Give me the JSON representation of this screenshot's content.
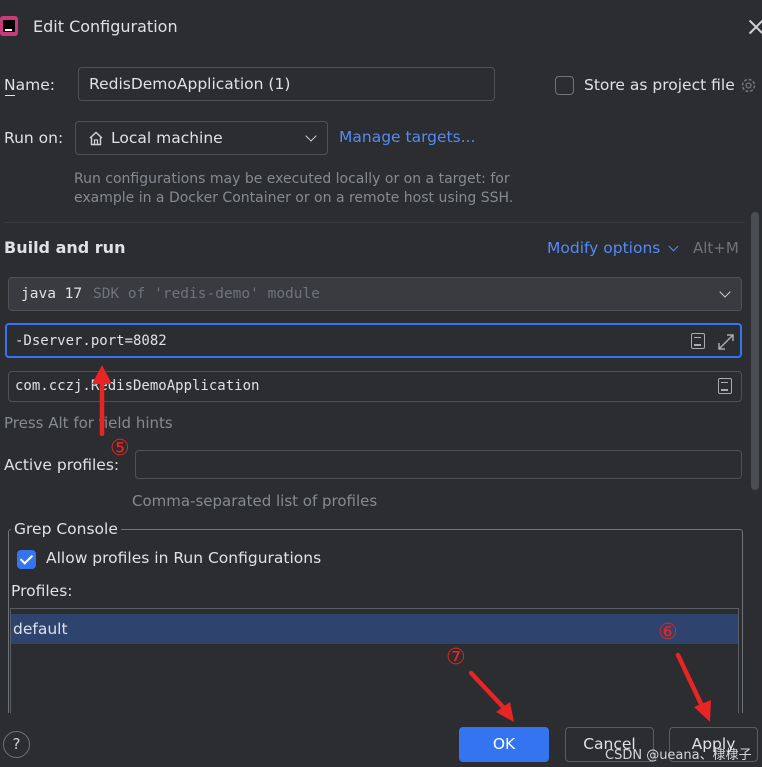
{
  "dialog": {
    "title": "Edit Configuration"
  },
  "name_field": {
    "label": "Name:",
    "value": "RedisDemoApplication (1)"
  },
  "store_as_project": {
    "label": "Store as project file",
    "checked": false
  },
  "run_on": {
    "label": "Run on:",
    "target": "Local machine",
    "manage_link": "Manage targets...",
    "hint": "Run configurations may be executed locally or on a target: for example in a Docker Container or on a remote host using SSH."
  },
  "build_run": {
    "heading": "Build and run",
    "modify_options": "Modify options",
    "shortcut": "Alt+M",
    "jdk": {
      "version": "java 17",
      "description": "SDK of 'redis-demo' module"
    },
    "vm_options": "-Dserver.port=8082",
    "main_class": "com.cczj.RedisDemoApplication",
    "field_hints": "Press Alt for field hints"
  },
  "active_profiles": {
    "label": "Active profiles:",
    "value": "",
    "hint": "Comma-separated list of profiles"
  },
  "grep_console": {
    "legend": "Grep Console",
    "allow_label": "Allow profiles in Run Configurations",
    "allow_checked": true,
    "profiles_label": "Profiles:",
    "profiles": [
      "default"
    ],
    "selected_profile": "default"
  },
  "annotations": {
    "five": "⑤",
    "six": "⑥",
    "seven": "⑦"
  },
  "buttons": {
    "help": "?",
    "ok": "OK",
    "cancel": "Cancel",
    "apply": "Apply"
  },
  "watermark": "CSDN @ueana、棣棣子",
  "colors": {
    "background": "#2b2d30",
    "accent": "#3574f0",
    "link": "#548af7",
    "annotation_red": "#e82424",
    "selection": "#2e436e"
  }
}
